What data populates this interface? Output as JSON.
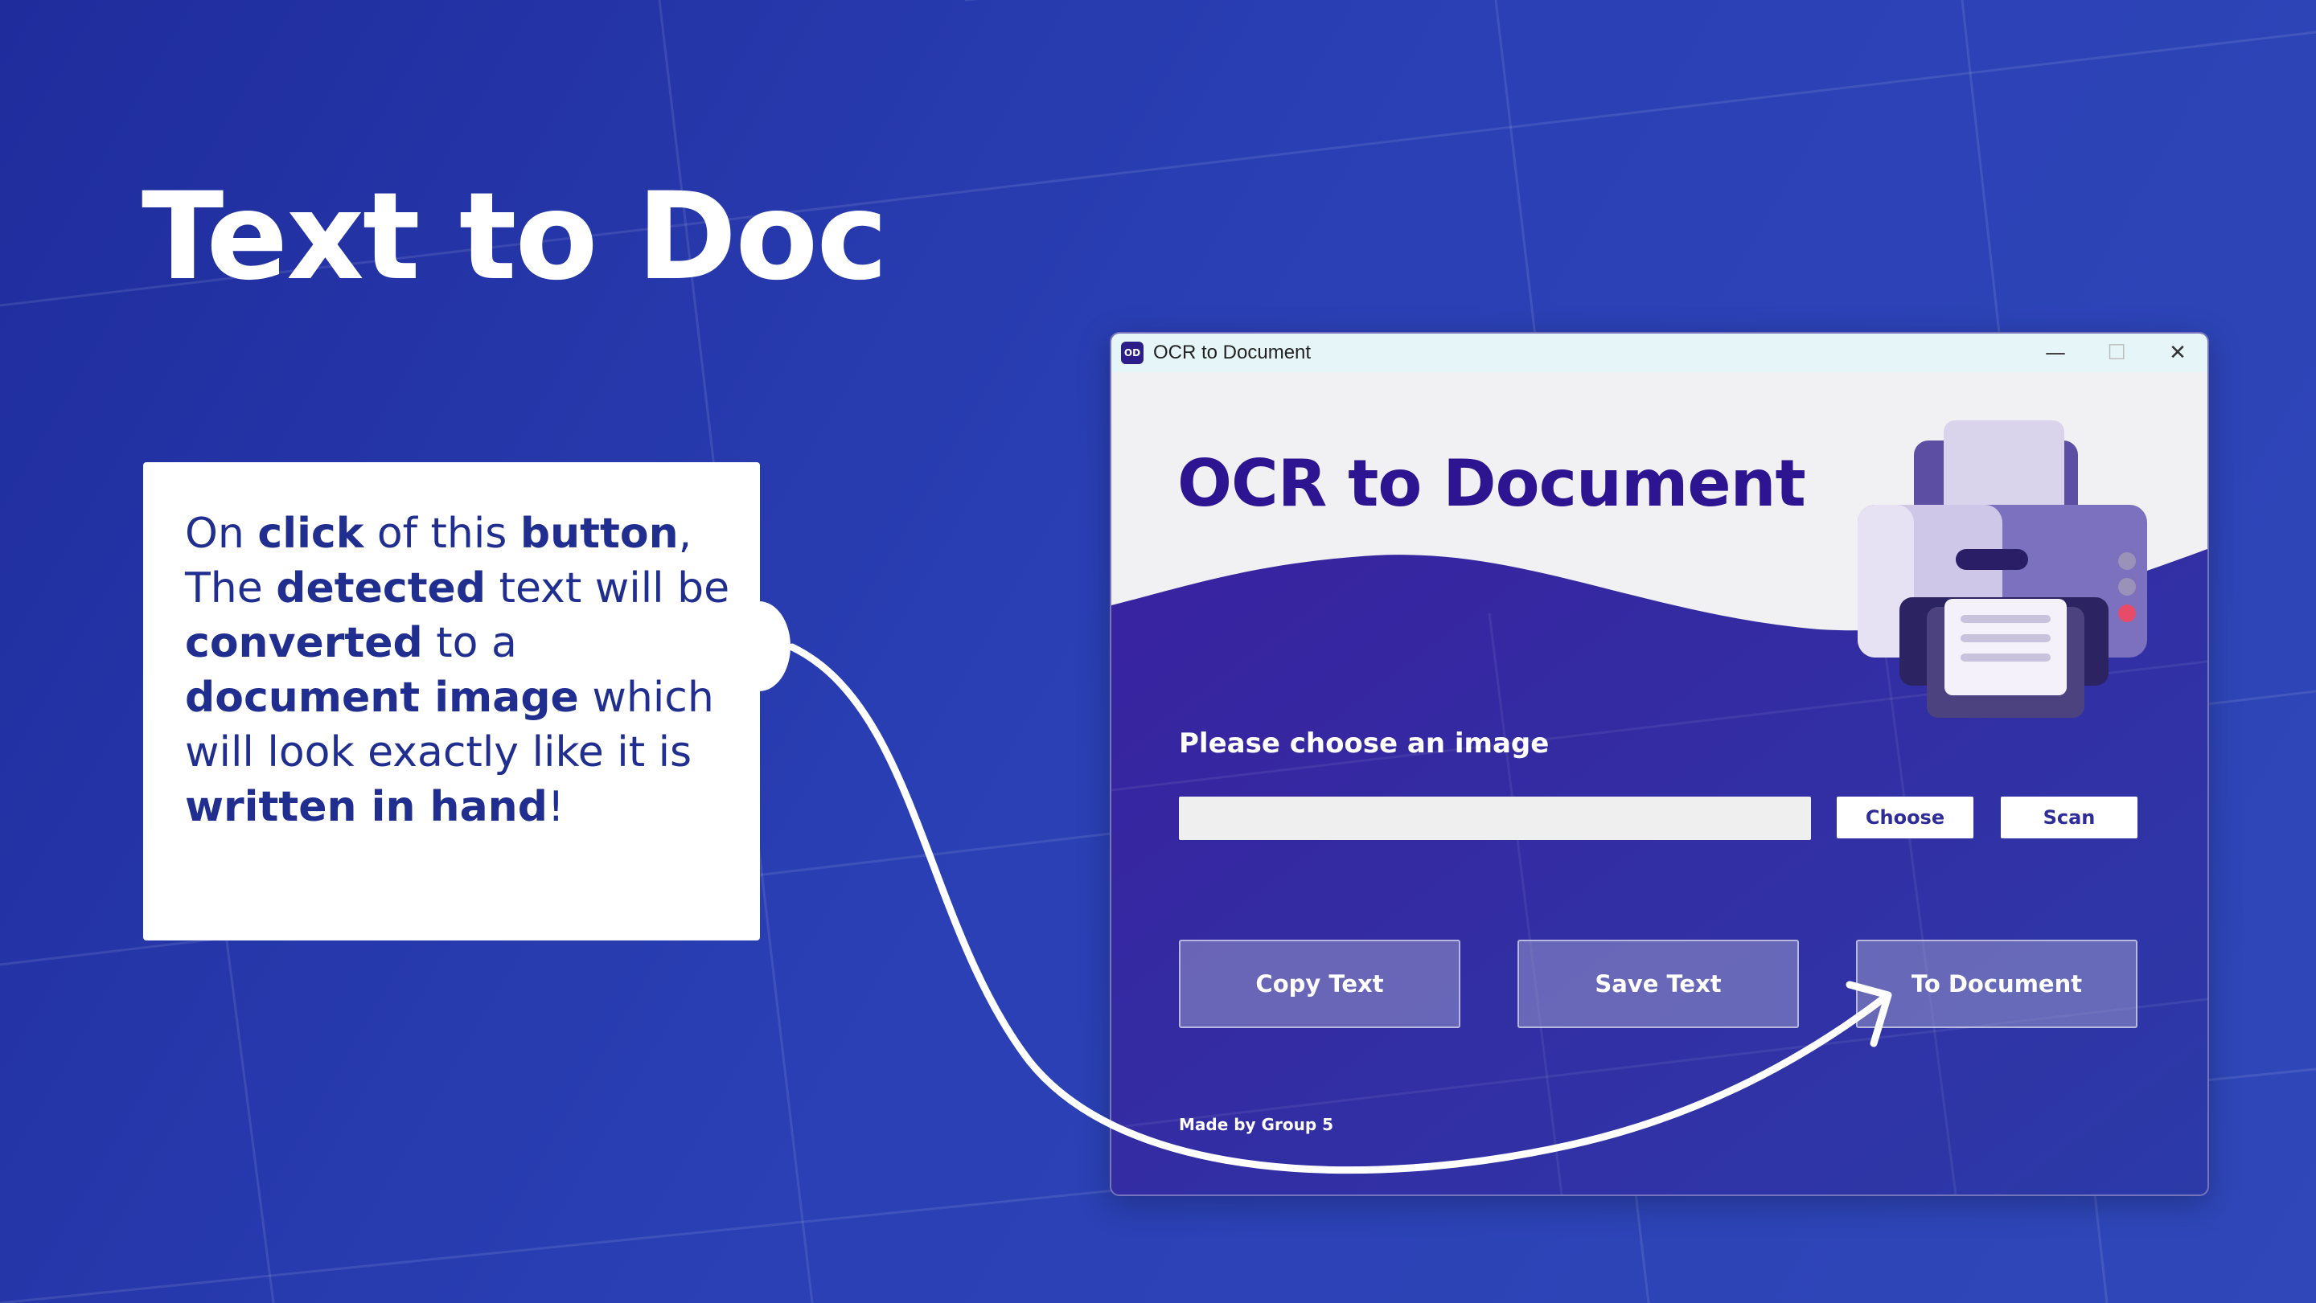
{
  "slide": {
    "title": "Text to Doc",
    "callout": {
      "segments": [
        {
          "text": "On ",
          "bold": false
        },
        {
          "text": "click",
          "bold": true
        },
        {
          "text": " of this ",
          "bold": false
        },
        {
          "text": "button",
          "bold": true
        },
        {
          "text": ", The ",
          "bold": false
        },
        {
          "text": "detected",
          "bold": true
        },
        {
          "text": " text will be ",
          "bold": false
        },
        {
          "text": "converted",
          "bold": true
        },
        {
          "text": " to a ",
          "bold": false
        },
        {
          "text": "document image",
          "bold": true
        },
        {
          "text": " which will look exactly like it is ",
          "bold": false
        },
        {
          "text": "written in hand",
          "bold": true
        },
        {
          "text": "!",
          "bold": false
        }
      ]
    }
  },
  "window": {
    "title": "OCR to Document",
    "icon_text": "OD",
    "controls": {
      "minimize": "—",
      "maximize": "☐",
      "close": "✕"
    }
  },
  "app": {
    "heading": "OCR to Document",
    "prompt": "Please choose an image",
    "path_value": "",
    "choose_label": "Choose",
    "scan_label": "Scan",
    "copy_label": "Copy Text",
    "save_label": "Save Text",
    "to_document_label": "To Document",
    "footer": "Made by Group 5",
    "icons": [
      "printer-icon"
    ]
  },
  "colors": {
    "background": "#2a3fb4",
    "accent": "#2d1592",
    "window_body": "#2d2c98",
    "text_callout": "#1f2e8f"
  }
}
